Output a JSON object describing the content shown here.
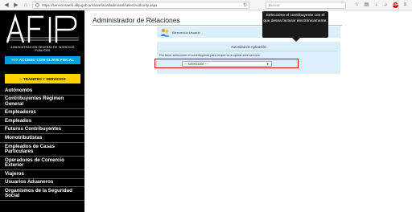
{
  "browser": {
    "url": "https://serviciosweb.afip.gob.ar/clavefiscal/adminrel/selectAuthority.aspx",
    "search_placeholder": "Buscar",
    "adblock_label": "ABP"
  },
  "sidebar": {
    "logo_text": "AFIP",
    "logo_subtitle": "ADMINISTRACION FEDERAL DE INGRESOS PUBLICOS",
    "clave_fiscal_button": ">>> ACCESO CON CLAVE FISCAL",
    "tramites_button": "TRÁMITES Y SERVICIOS",
    "menu_items": [
      "Autónomos",
      "Contribuyentes Régimen General",
      "Empleadores",
      "Empleados",
      "Futuros Contribuyentes",
      "Monotributistas",
      "Empleados de Casas Particulares",
      "Operadores de Comercio Exterior",
      "Viajeros",
      "Usuarios Aduaneros",
      "Organismos de la Seguridad Social"
    ]
  },
  "main": {
    "title": "Administrador de Relaciones",
    "welcome_text": "Bienvenido Usuario",
    "panel_title": "Autoridad de Aplicación",
    "panel_text": "Por favor seleccione el contribuyente para el que va a operar este servicio",
    "select_value": "--- seleccione ---"
  },
  "tooltip": {
    "text": "Seleccione el contribuyente con el que desea facturar electrónicamente."
  },
  "colors": {
    "sidebar_bg": "#000000",
    "clave_button": "#009fd9",
    "tramites_button": "#ffd200",
    "panel_bg": "#dbeef9",
    "highlight": "#dd0000"
  }
}
